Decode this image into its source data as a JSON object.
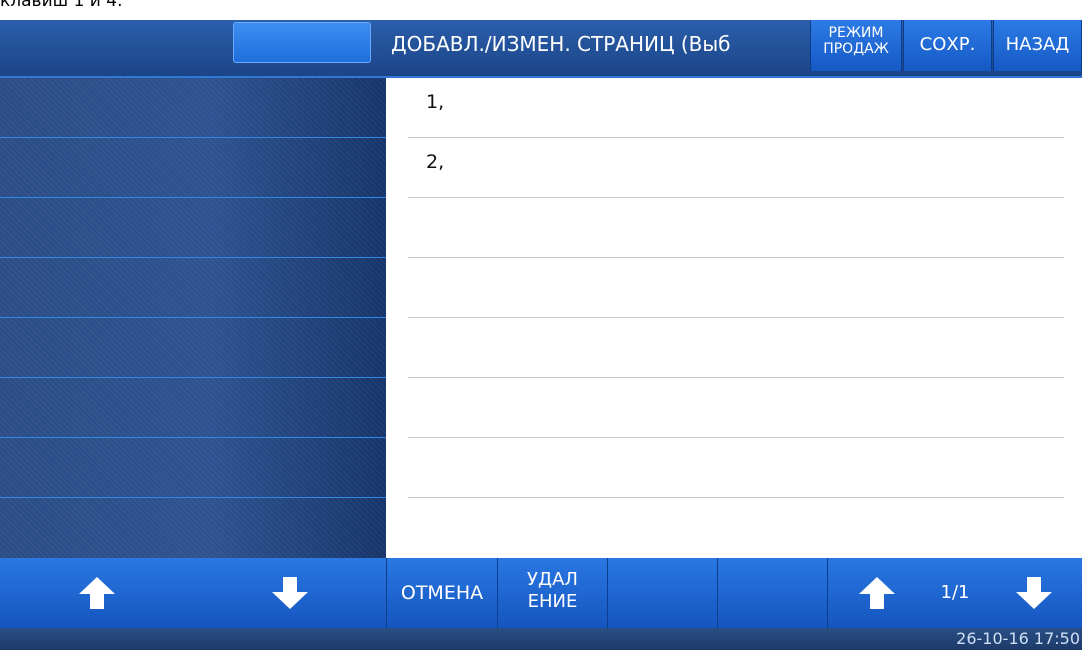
{
  "caption": "клавиш 1 и 4.",
  "header": {
    "title": "ДОБАВЛ./ИЗМЕН. СТРАНИЦ (Выб",
    "mode_button": {
      "line1": "РЕЖИМ",
      "line2": "ПРОДАЖ"
    },
    "save_button": "СОХР.",
    "back_button": "НАЗАД"
  },
  "list": {
    "rows": [
      "1,",
      "2,",
      "",
      "",
      "",
      "",
      "",
      ""
    ]
  },
  "bottom": {
    "cancel_button": "ОТМЕНА",
    "delete_button": {
      "line1": "УДАЛ",
      "line2": "ЕНИЕ"
    },
    "page_indicator": "1/1"
  },
  "status": {
    "datetime": "26-10-16 17:50"
  },
  "icons": [
    "arrow-up-icon",
    "arrow-down-icon"
  ],
  "colors": {
    "accent": "#1f6fdc",
    "background": "#1d3f7a"
  }
}
